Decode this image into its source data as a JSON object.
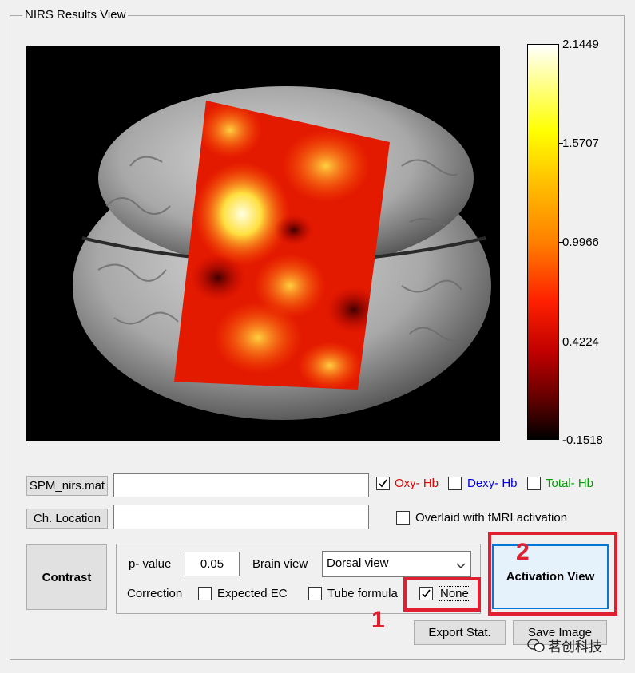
{
  "group_title": "NIRS Results View",
  "colorbar": {
    "max_label": "2.1449",
    "ticks": [
      "1.5707",
      "0.9966",
      "0.4224"
    ],
    "min_label": "-0.1518"
  },
  "buttons": {
    "spm_file": "SPM_nirs.mat",
    "ch_location": "Ch. Location",
    "contrast": "Contrast",
    "activation_view": "Activation View",
    "export_stat": "Export Stat.",
    "save_image": "Save Image"
  },
  "hb": {
    "oxy": {
      "label": "Oxy- Hb",
      "color": "#e00000",
      "checked": true
    },
    "dexy": {
      "label": "Dexy- Hb",
      "color": "#0000e0",
      "checked": false
    },
    "total": {
      "label": "Total- Hb",
      "color": "#00a000",
      "checked": false
    }
  },
  "overlaid_label": "Overlaid with fMRI activation",
  "pvalue": {
    "label": "p- value",
    "value": "0.05"
  },
  "brain_view": {
    "label": "Brain view",
    "selected": "Dorsal view"
  },
  "correction": {
    "label": "Correction",
    "expected_ec": "Expected EC",
    "tube_formula": "Tube formula",
    "none": "None"
  },
  "annotations": {
    "marker_1": "1",
    "marker_2": "2"
  },
  "watermark": "茗创科技",
  "colors": {
    "highlight": "#e02030",
    "accent": "#0078d7"
  }
}
